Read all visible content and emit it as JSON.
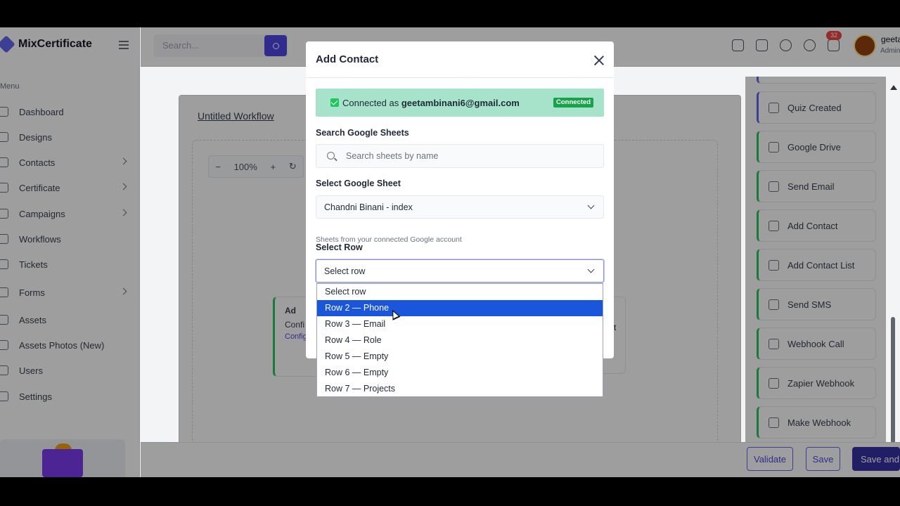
{
  "app": {
    "name": "MixCertificate"
  },
  "header": {
    "search_placeholder": "Search...",
    "notification_count": "32",
    "user_name": "geeta",
    "user_role": "Admin"
  },
  "sidebar": {
    "menu_label": "Menu",
    "items": [
      {
        "label": "Dashboard",
        "icon": "home-icon",
        "chevron": false
      },
      {
        "label": "Designs",
        "icon": "palette-icon",
        "chevron": false
      },
      {
        "label": "Contacts",
        "icon": "phone-icon",
        "chevron": true
      },
      {
        "label": "Certificate",
        "icon": "certificate-icon",
        "chevron": true
      },
      {
        "label": "Campaigns",
        "icon": "send-icon",
        "chevron": true
      },
      {
        "label": "Workflows",
        "icon": "workflow-icon",
        "chevron": false
      },
      {
        "label": "Tickets",
        "icon": "headset-icon",
        "chevron": false
      },
      {
        "label": "Forms",
        "icon": "form-icon",
        "chevron": true
      },
      {
        "label": "Assets",
        "icon": "box-icon",
        "chevron": false
      },
      {
        "label": "Assets Photos (New)",
        "icon": "box-icon",
        "chevron": false
      },
      {
        "label": "Users",
        "icon": "users-icon",
        "chevron": false
      },
      {
        "label": "Settings",
        "icon": "gear-icon",
        "chevron": false
      }
    ]
  },
  "workflow": {
    "title": "Untitled Workflow",
    "zoom_minus": "−",
    "zoom_level": "100%",
    "zoom_plus": "+",
    "zoom_reset": "↻",
    "node": {
      "title": "Ad",
      "text": "Confi for ne",
      "link": "Configu"
    },
    "node2": {
      "text": "t"
    }
  },
  "palette": {
    "items": [
      {
        "label": "Quiz Created",
        "icon": "grid-icon"
      },
      {
        "label": "Google Drive",
        "icon": "folder-icon"
      },
      {
        "label": "Send Email",
        "icon": "mail-icon"
      },
      {
        "label": "Add Contact",
        "icon": "users-icon"
      },
      {
        "label": "Add Contact List",
        "icon": "user-plus-icon"
      },
      {
        "label": "Send SMS",
        "icon": "chat-icon"
      },
      {
        "label": "Webhook Call",
        "icon": "link-icon"
      },
      {
        "label": "Zapier Webhook",
        "icon": "bolt-icon"
      },
      {
        "label": "Make Webhook",
        "icon": "bolt-icon"
      }
    ]
  },
  "footer": {
    "validate": "Validate",
    "save": "Save",
    "save_and": "Save and P"
  },
  "modal": {
    "title": "Add Contact",
    "connected_prefix": "Connected as ",
    "connected_email": "geetambinani6@gmail.com",
    "connected_badge": "Connected",
    "search_label": "Search Google Sheets",
    "search_placeholder": "Search sheets by name",
    "sheet_label": "Select Google Sheet",
    "sheet_value": "Chandni Binani - index",
    "sheet_hint": "Sheets from your connected Google account",
    "row_label": "Select Row",
    "row_value": "Select row"
  },
  "row_dropdown": {
    "highlighted_index": 1,
    "options": [
      "Select row",
      "Row 2 — Phone",
      "Row 3 — Email",
      "Row 4 — Role",
      "Row 5 — Empty",
      "Row 6 — Empty",
      "Row 7 — Projects"
    ]
  },
  "colors": {
    "accent": "#4f46e5",
    "success": "#22c55e",
    "highlight": "#1a56db",
    "connected_bg": "#a7e3cb"
  }
}
